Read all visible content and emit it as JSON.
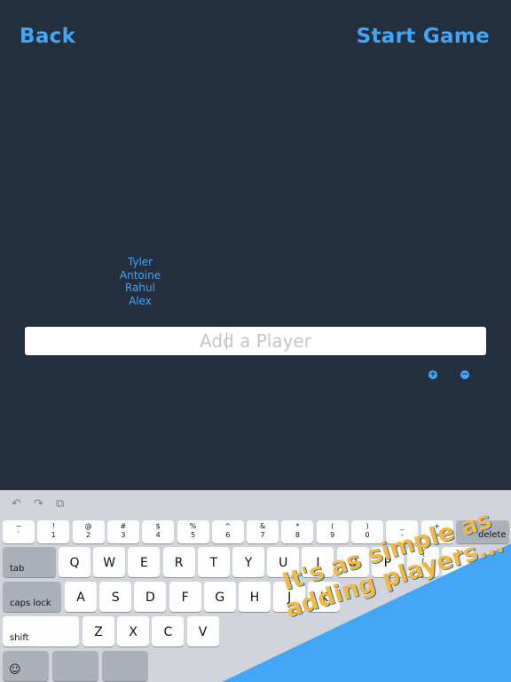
{
  "header": {
    "back_label": "Back",
    "start_label": "Start Game"
  },
  "players": [
    "Tyler",
    "Antoine",
    "Rahul",
    "Alex"
  ],
  "add_player": {
    "placeholder": "Add a Player",
    "value": ""
  },
  "controls": {
    "add_symbol": "+",
    "remove_symbol": "−"
  },
  "keyboard": {
    "toolbar": {
      "undo": "↶",
      "redo": "↷",
      "paste": "⧉"
    },
    "number_row": [
      {
        "top": "~",
        "bot": "`"
      },
      {
        "top": "!",
        "bot": "1"
      },
      {
        "top": "@",
        "bot": "2"
      },
      {
        "top": "#",
        "bot": "3"
      },
      {
        "top": "$",
        "bot": "4"
      },
      {
        "top": "%",
        "bot": "5"
      },
      {
        "top": "^",
        "bot": "6"
      },
      {
        "top": "&",
        "bot": "7"
      },
      {
        "top": "*",
        "bot": "8"
      },
      {
        "top": "(",
        "bot": "9"
      },
      {
        "top": ")",
        "bot": "0"
      },
      {
        "top": "_",
        "bot": "-"
      },
      {
        "top": "+",
        "bot": "="
      }
    ],
    "delete_label": "delete",
    "tab_label": "tab",
    "qwerty_row": [
      "Q",
      "W",
      "E",
      "R",
      "T",
      "Y",
      "U",
      "I",
      "O",
      "P"
    ],
    "bracket_keys": [
      {
        "top": "{",
        "bot": "["
      },
      {
        "top": "}",
        "bot": "]"
      }
    ],
    "caps_label": "caps lock",
    "home_row": [
      "A",
      "S",
      "D",
      "F",
      "G",
      "H",
      "J",
      "K"
    ],
    "shift_label": "shift",
    "bottom_letters": [
      "Z",
      "X",
      "C",
      "V"
    ],
    "emoji_symbol": "☺"
  },
  "banner": {
    "text": "It's as simple as adding players...",
    "background_color": "#42a5f5",
    "text_color": "#f5b942"
  },
  "colors": {
    "background": "#232f3e",
    "accent": "#42a5f5"
  }
}
